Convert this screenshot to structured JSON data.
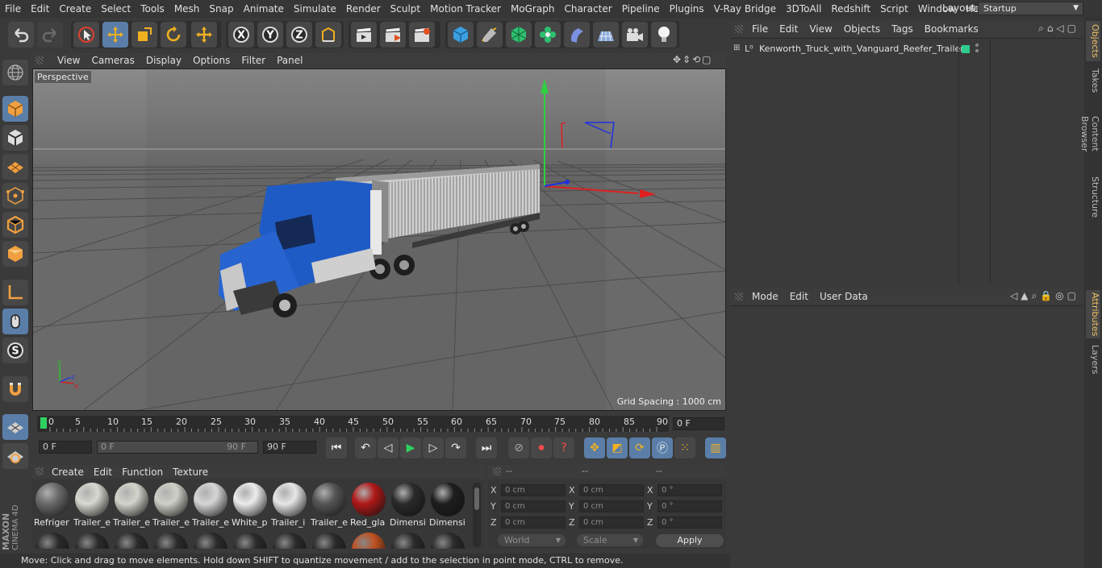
{
  "menubar": {
    "items": [
      "File",
      "Edit",
      "Create",
      "Select",
      "Tools",
      "Mesh",
      "Snap",
      "Animate",
      "Simulate",
      "Render",
      "Sculpt",
      "Motion Tracker",
      "MoGraph",
      "Character",
      "Pipeline",
      "Plugins",
      "V-Ray Bridge",
      "3DToAll",
      "Redshift",
      "Script",
      "Window",
      "Help"
    ],
    "layout_label": "Layout:",
    "layout_value": "Startup"
  },
  "toolbar": {
    "x_label": "X",
    "y_label": "Y",
    "z_label": "Z"
  },
  "viewport": {
    "menu": [
      "View",
      "Cameras",
      "Display",
      "Options",
      "Filter",
      "Panel"
    ],
    "camera_label": "Perspective",
    "grid_spacing": "Grid Spacing : 1000 cm"
  },
  "timeline": {
    "ticks": [
      "0",
      "5",
      "10",
      "15",
      "20",
      "25",
      "30",
      "35",
      "40",
      "45",
      "50",
      "55",
      "60",
      "65",
      "70",
      "75",
      "80",
      "85",
      "90"
    ],
    "current_frame": "0 F",
    "start_field": "0 F",
    "range_start": "0 F",
    "range_end": "90 F",
    "end_field": "90 F"
  },
  "materials": {
    "menu": [
      "Create",
      "Edit",
      "Function",
      "Texture"
    ],
    "items": [
      {
        "name": "Refriger",
        "color": "#6a6a6a"
      },
      {
        "name": "Trailer_e",
        "color": "#d8d8d0"
      },
      {
        "name": "Trailer_e",
        "color": "#d4d4cc"
      },
      {
        "name": "Trailer_e",
        "color": "#d0d0c8"
      },
      {
        "name": "Trailer_e",
        "color": "#d6d6d6"
      },
      {
        "name": "White_p",
        "color": "#ececec"
      },
      {
        "name": "Trailer_i",
        "color": "#e6e6e6"
      },
      {
        "name": "Trailer_e",
        "color": "#555555"
      },
      {
        "name": "Red_gla",
        "color": "#b01818"
      },
      {
        "name": "Dimensi",
        "color": "#2a2a2a"
      },
      {
        "name": "Dimensi",
        "color": "#1e1e1e"
      }
    ]
  },
  "coords": {
    "headers": [
      "--",
      "--",
      "--"
    ],
    "rows": [
      {
        "a": "X",
        "av": "0 cm",
        "b": "X",
        "bv": "0 cm",
        "c": "X",
        "cv": "0 °"
      },
      {
        "a": "Y",
        "av": "0 cm",
        "b": "Y",
        "bv": "0 cm",
        "c": "Y",
        "cv": "0 °"
      },
      {
        "a": "Z",
        "av": "0 cm",
        "b": "Z",
        "bv": "0 cm",
        "c": "Z",
        "cv": "0 °"
      }
    ],
    "world": "World",
    "scale": "Scale",
    "apply": "Apply"
  },
  "objects": {
    "menu": [
      "File",
      "Edit",
      "View",
      "Objects",
      "Tags",
      "Bookmarks"
    ],
    "root_name": "Kenworth_Truck_with_Vanguard_Reefer_Trailer",
    "layer_color": "#2ecc8a"
  },
  "attributes": {
    "menu": [
      "Mode",
      "Edit",
      "User Data"
    ]
  },
  "right_tabs": [
    "Objects",
    "Takes",
    "Content Browser",
    "Structure",
    "Attributes",
    "Layers"
  ],
  "status": "Move: Click and drag to move elements. Hold down SHIFT to quantize movement / add to the selection in point mode, CTRL to remove.",
  "logo": {
    "line1": "MAXON",
    "line2": "CINEMA 4D"
  },
  "colors": {
    "accent": "#5a7ea8",
    "truck_blue": "#1f5bc4"
  }
}
